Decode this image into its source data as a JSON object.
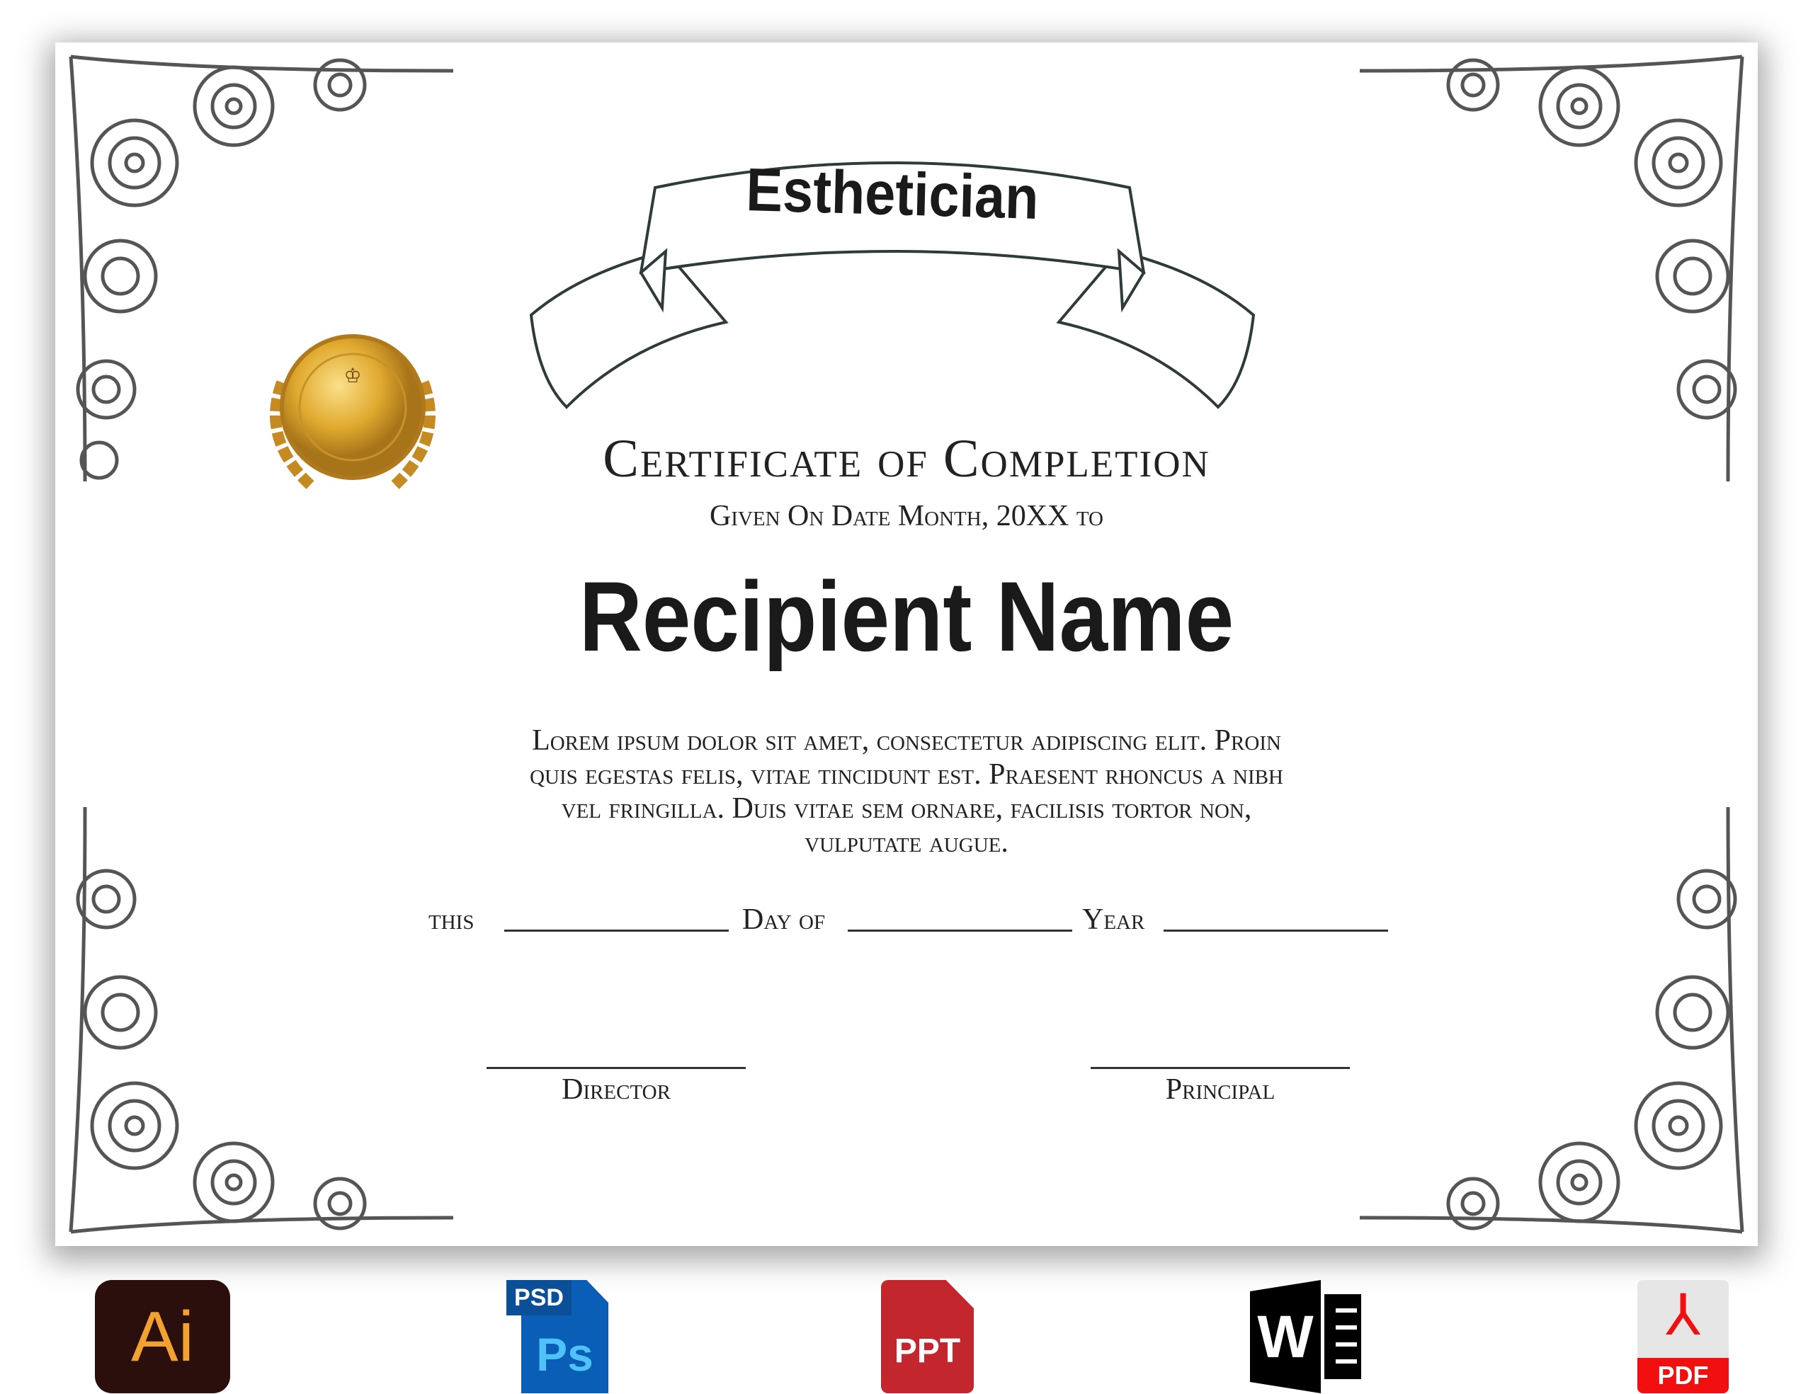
{
  "certificate": {
    "ribbon_title": "Esthetician",
    "heading": "Certificate of Completion",
    "given_on": "Given On Date Month, 20XX to",
    "recipient": "Recipient Name",
    "body_lines": [
      "Lorem ipsum dolor sit amet, consectetur adipiscing elit. Proin",
      "quis egestas felis, vitae tincidunt est. Praesent rhoncus a nibh",
      "vel fringilla. Duis vitae sem ornare, facilisis tortor non,",
      "vulputate augue."
    ],
    "date_line": {
      "this": "this",
      "day_of": "Day of",
      "year": "Year"
    },
    "signatures": {
      "left": "Director",
      "right": "Principal"
    }
  },
  "formats": {
    "ai": "Ai",
    "psd_tag": "PSD",
    "psd": "Ps",
    "ppt": "PPT",
    "word": "W",
    "pdf": "PDF"
  },
  "colors": {
    "gold": "#d4a52a",
    "ai_bg": "#2b0f0c",
    "ai_fg": "#f2a22e",
    "ps_bg": "#0a5eb5",
    "ps_fg": "#4fc3f7",
    "ppt": "#c3262d",
    "pdf": "#f20f0f"
  }
}
